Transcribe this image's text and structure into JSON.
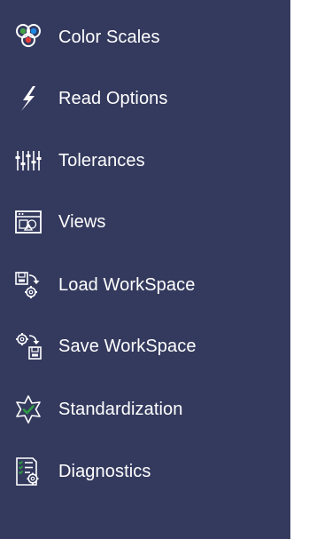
{
  "menu": {
    "items": [
      {
        "label": "Color Scales",
        "icon": "color-scales-icon",
        "colors": {
          "red": "#e53935",
          "green": "#43a047",
          "blue": "#1e88e5"
        }
      },
      {
        "label": "Read Options",
        "icon": "lightning-icon"
      },
      {
        "label": "Tolerances",
        "icon": "sliders-icon"
      },
      {
        "label": "Views",
        "icon": "views-window-icon"
      },
      {
        "label": "Load WorkSpace",
        "icon": "load-workspace-icon"
      },
      {
        "label": "Save WorkSpace",
        "icon": "save-workspace-icon"
      },
      {
        "label": "Standardization",
        "icon": "star-check-icon",
        "accent": "#2e9e43"
      },
      {
        "label": "Diagnostics",
        "icon": "diagnostics-icon",
        "accent": "#2e9e43"
      }
    ]
  },
  "colors": {
    "background": "#343a5e",
    "text": "#ffffff"
  }
}
